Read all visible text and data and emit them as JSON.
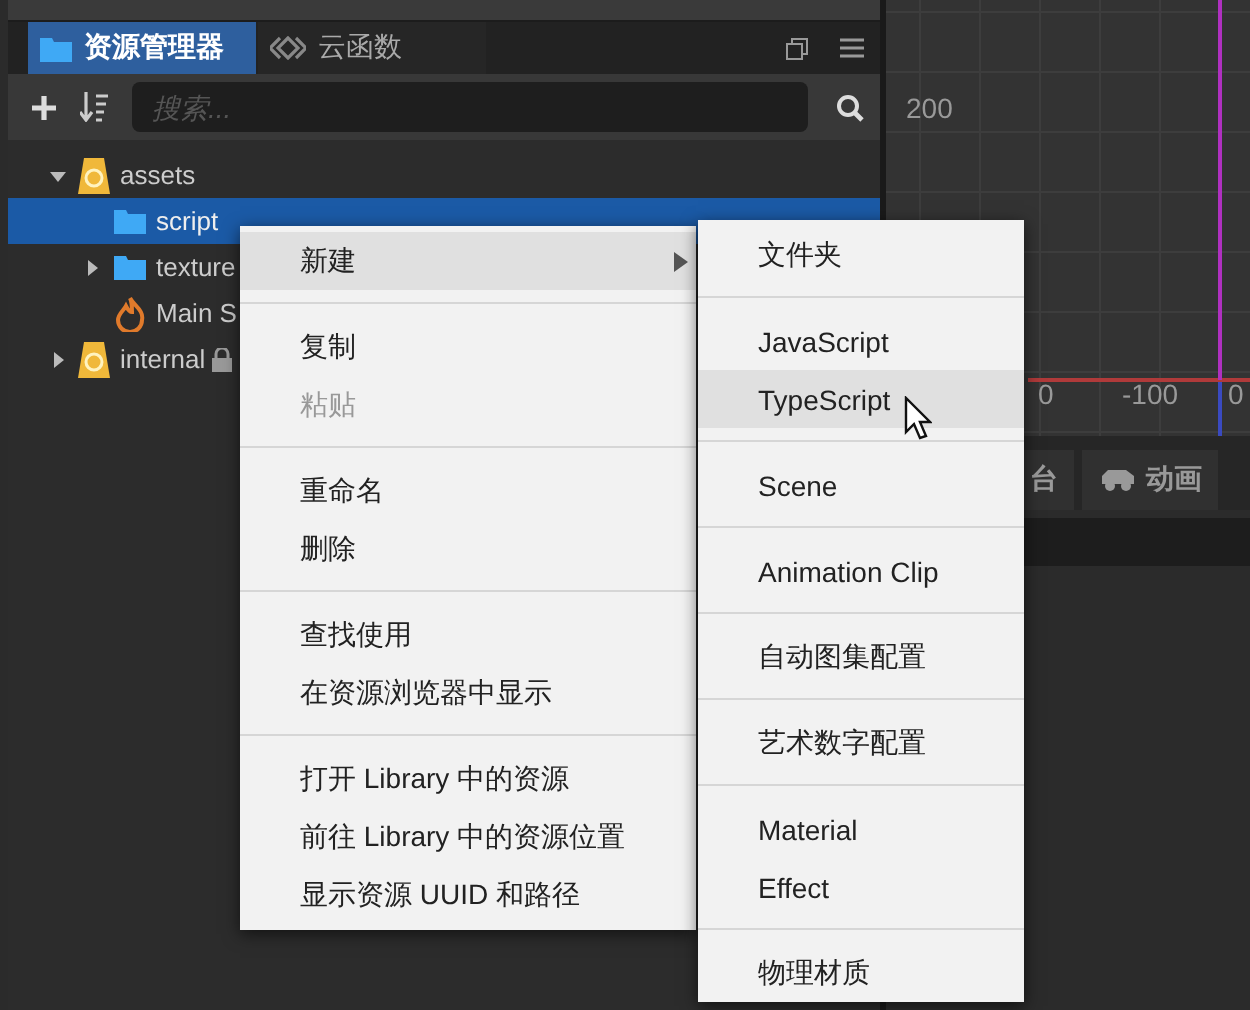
{
  "panel": {
    "tabs": [
      {
        "label": "资源管理器",
        "selected": true
      },
      {
        "label": "云函数",
        "selected": false
      }
    ],
    "search": {
      "placeholder": "搜索..."
    },
    "tree": [
      {
        "label": "assets",
        "kind": "db",
        "expanded": true,
        "selected": false,
        "locked": false,
        "children": [
          {
            "label": "script",
            "kind": "folder",
            "selected": true,
            "locked": false
          },
          {
            "label": "texture",
            "kind": "folder",
            "expanded": false,
            "selected": false,
            "locked": false
          },
          {
            "label": "Main S",
            "kind": "scene",
            "selected": false,
            "locked": false
          }
        ]
      },
      {
        "label": "internal",
        "kind": "db",
        "expanded": false,
        "selected": false,
        "locked": true
      }
    ]
  },
  "scene": {
    "axis_labels": [
      "200",
      "0",
      "-100",
      "0"
    ],
    "tabs": [
      {
        "label": "台",
        "selected": false
      },
      {
        "label": "动画",
        "selected": false
      }
    ]
  },
  "context_menu": {
    "groups": [
      [
        {
          "label": "新建",
          "submenu": true,
          "highlighted": true,
          "disabled": false
        }
      ],
      [
        {
          "label": "复制",
          "submenu": false,
          "highlighted": false,
          "disabled": false
        },
        {
          "label": "粘贴",
          "submenu": false,
          "highlighted": false,
          "disabled": true
        }
      ],
      [
        {
          "label": "重命名",
          "submenu": false,
          "highlighted": false,
          "disabled": false
        },
        {
          "label": "删除",
          "submenu": false,
          "highlighted": false,
          "disabled": false
        }
      ],
      [
        {
          "label": "查找使用",
          "submenu": false,
          "highlighted": false,
          "disabled": false
        },
        {
          "label": "在资源浏览器中显示",
          "submenu": false,
          "highlighted": false,
          "disabled": false
        }
      ],
      [
        {
          "label": "打开 Library 中的资源",
          "submenu": false,
          "highlighted": false,
          "disabled": false
        },
        {
          "label": "前往 Library 中的资源位置",
          "submenu": false,
          "highlighted": false,
          "disabled": false
        },
        {
          "label": "显示资源 UUID 和路径",
          "submenu": false,
          "highlighted": false,
          "disabled": false
        }
      ]
    ]
  },
  "submenu": {
    "groups": [
      [
        {
          "label": "文件夹",
          "highlighted": false
        }
      ],
      [
        {
          "label": "JavaScript",
          "highlighted": false
        },
        {
          "label": "TypeScript",
          "highlighted": true
        }
      ],
      [
        {
          "label": "Scene",
          "highlighted": false
        }
      ],
      [
        {
          "label": "Animation Clip",
          "highlighted": false
        }
      ],
      [
        {
          "label": "自动图集配置",
          "highlighted": false
        }
      ],
      [
        {
          "label": "艺术数字配置",
          "highlighted": false
        }
      ],
      [
        {
          "label": "Material",
          "highlighted": false
        },
        {
          "label": "Effect",
          "highlighted": false
        }
      ],
      [
        {
          "label": "物理材质",
          "highlighted": false
        }
      ]
    ]
  }
}
